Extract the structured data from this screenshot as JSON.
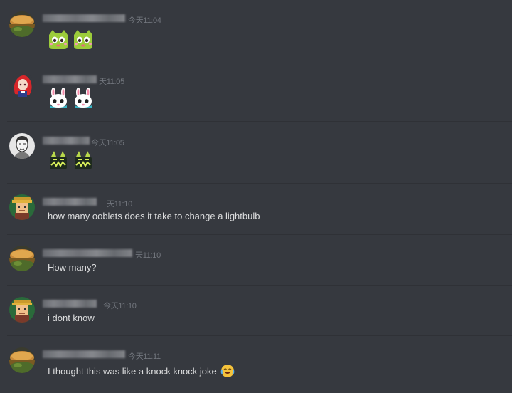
{
  "messages": [
    {
      "time": "今天11:04",
      "avatar": "bread-avatar",
      "emojis": [
        "frog-ooblet-emoji",
        "frog-ooblet-emoji"
      ]
    },
    {
      "time": "天11:05",
      "avatar": "red-hair-girl-avatar",
      "emojis": [
        "bunny-ooblet-emoji",
        "bunny-ooblet-emoji"
      ]
    },
    {
      "time": "今天11:05",
      "avatar": "sketch-portrait-avatar",
      "emojis": [
        "dark-ooblet-emoji",
        "dark-ooblet-emoji"
      ]
    },
    {
      "time": "天11:10",
      "avatar": "pixel-character-avatar",
      "text": "how many ooblets does it take to change a lightbulb"
    },
    {
      "time": "天11:10",
      "avatar": "bread-avatar",
      "text": "How many?"
    },
    {
      "time": "今天11:10",
      "avatar": "pixel-character-avatar",
      "text": "i dont know"
    },
    {
      "time": "今天11:11",
      "avatar": "bread-avatar",
      "text": "I thought this was like a knock knock joke",
      "trailing_emoji": "joy-emoji"
    }
  ],
  "colors": {
    "background": "#36393f",
    "text": "#dcddde",
    "timestamp": "#72767d",
    "divider": "#2f3136"
  }
}
